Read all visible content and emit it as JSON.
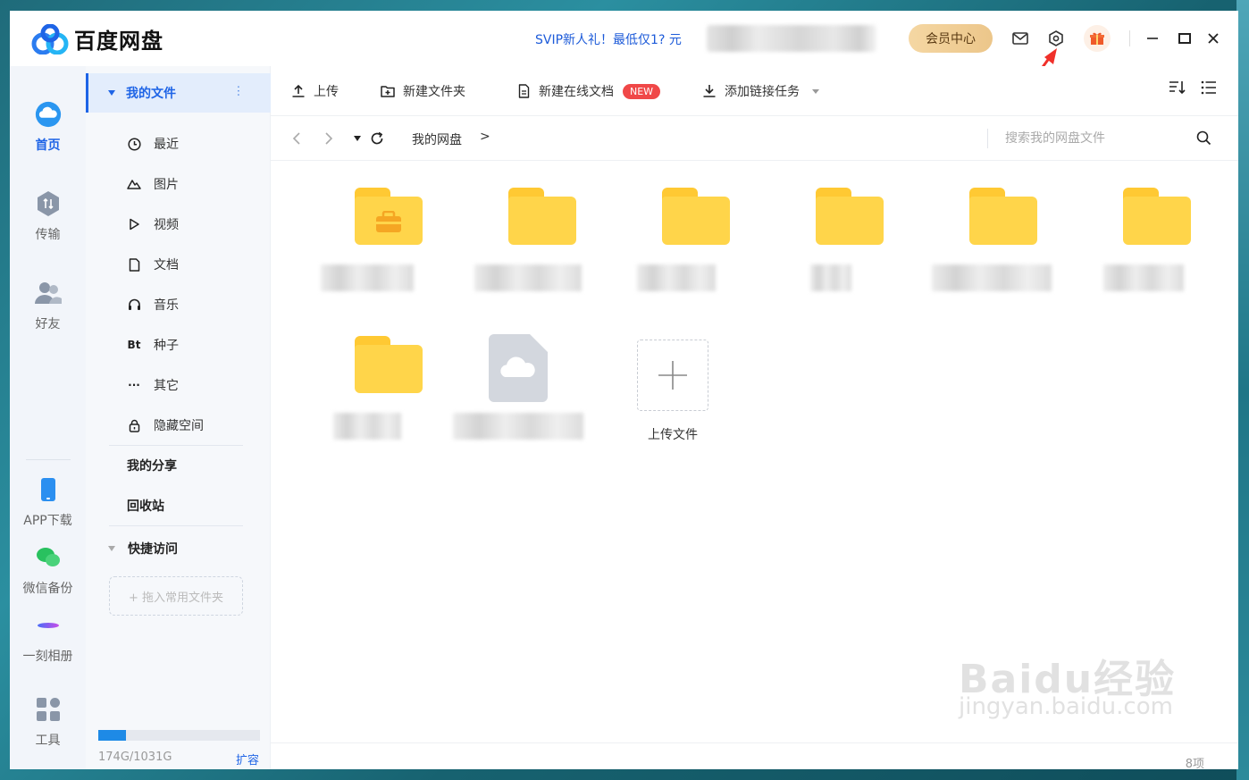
{
  "app": {
    "name": "百度网盘"
  },
  "header": {
    "promo": "SVIP新人礼！最低仅1? 元",
    "vip_center": "会员中心"
  },
  "leftnav": {
    "home": "首页",
    "transfer": "传输",
    "friends": "好友",
    "app_download": "APP下载",
    "wechat_backup": "微信备份",
    "album": "一刻相册",
    "tools": "工具"
  },
  "sidebar": {
    "my_files": "我的文件",
    "items": [
      {
        "label": "最近",
        "icon": "clock-icon"
      },
      {
        "label": "图片",
        "icon": "image-icon"
      },
      {
        "label": "视频",
        "icon": "play-icon"
      },
      {
        "label": "文档",
        "icon": "doc-icon"
      },
      {
        "label": "音乐",
        "icon": "headphone-icon"
      },
      {
        "label": "种子",
        "icon": "bt-icon",
        "glyph": "Bt"
      },
      {
        "label": "其它",
        "icon": "more-icon",
        "glyph": "···"
      },
      {
        "label": "隐藏空间",
        "icon": "lock-icon"
      }
    ],
    "my_share": "我的分享",
    "recycle": "回收站",
    "quick_access": "快捷访问",
    "drop_hint": "+ 拖入常用文件夹",
    "quota_text": "174G/1031G",
    "quota_used_fraction": 0.169,
    "expand": "扩容"
  },
  "toolbar": {
    "upload": "上传",
    "new_folder": "新建文件夹",
    "new_doc": "新建在线文档",
    "new_badge": "NEW",
    "add_link": "添加链接任务"
  },
  "address": {
    "crumb": "我的网盘",
    "sep": ">",
    "search_placeholder": "搜索我的网盘文件"
  },
  "content": {
    "upload_file": "上传文件",
    "item_count": "8项"
  },
  "watermark": {
    "line1": "Baidu经验",
    "line2": "jingyan.baidu.com"
  },
  "colors": {
    "accent": "#1e64e6",
    "folder": "#ffd54a",
    "badge": "#f04848"
  }
}
